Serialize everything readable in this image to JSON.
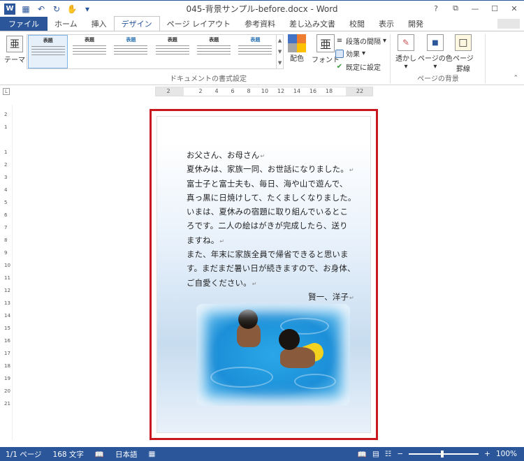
{
  "titlebar": {
    "title": "045-背景サンプル-before.docx - Word",
    "logo": "W",
    "qat": [
      "save-icon",
      "undo-icon",
      "redo-icon",
      "touch-mode-icon",
      "customize-icon"
    ],
    "controls": [
      "?",
      "⧉",
      "—",
      "☐",
      "✕"
    ]
  },
  "tabs": [
    {
      "label": "ファイル"
    },
    {
      "label": "ホーム"
    },
    {
      "label": "挿入"
    },
    {
      "label": "デザイン"
    },
    {
      "label": "ページ レイアウト"
    },
    {
      "label": "参考資料"
    },
    {
      "label": "差し込み文書"
    },
    {
      "label": "校閲"
    },
    {
      "label": "表示"
    },
    {
      "label": "開発"
    }
  ],
  "ribbon": {
    "theme_label": "テーマ",
    "theme_icon_text": "亜",
    "gallery_thumbs": [
      {
        "title": "表題",
        "blue": false
      },
      {
        "title": "表題",
        "blue": false
      },
      {
        "title": "表題",
        "blue": true
      },
      {
        "title": "表題",
        "blue": false
      },
      {
        "title": "表題",
        "blue": false
      },
      {
        "title": "表題",
        "blue": true
      }
    ],
    "doc_format_group": "ドキュメントの書式設定",
    "colors_label": "配色",
    "fonts_label": "フォント",
    "fonts_icon_text": "亜",
    "paragraph_spacing": "段落の間隔",
    "effects": "効果",
    "set_default": "既定に設定",
    "watermark": "透かし",
    "page_color": "ページの色",
    "page_borders_1": "ページ",
    "page_borders_2": "罫線",
    "page_bg_group": "ページの背景"
  },
  "ruler": {
    "ticks": [
      "2",
      "2",
      "4",
      "6",
      "8",
      "10",
      "12",
      "14",
      "16",
      "18",
      "22"
    ],
    "corner": "L"
  },
  "vruler": {
    "ticks": [
      "2",
      "1",
      "1",
      "2",
      "3",
      "4",
      "5",
      "6",
      "7",
      "8",
      "9",
      "10",
      "11",
      "12",
      "13",
      "14",
      "15",
      "16",
      "17",
      "18",
      "19",
      "20",
      "21"
    ]
  },
  "letter": {
    "lines": [
      {
        "text": "お父さん、お母さん",
        "mark": "↵"
      },
      {
        "text": "夏休みは、家族一同、お世話になりました。",
        "mark": "↵"
      },
      {
        "text": "富士子と富士夫も、毎日、海や山で遊んで、",
        "mark": ""
      },
      {
        "text": "真っ黒に日焼けして、たくましくなりました。",
        "mark": ""
      },
      {
        "text": "いまは、夏休みの宿題に取り組んでいるとこ",
        "mark": ""
      },
      {
        "text": "ろです。二人の絵はがきが完成したら、送り",
        "mark": ""
      },
      {
        "text": "ますね。",
        "mark": "↵"
      },
      {
        "text": "また、年末に家族全員で帰省できると思いま",
        "mark": ""
      },
      {
        "text": "す。まだまだ暑い日が続きますので、お身体、",
        "mark": ""
      },
      {
        "text": "ご自愛ください。",
        "mark": "↵"
      }
    ],
    "signature": "賢一、洋子",
    "signature_mark": "↵"
  },
  "status": {
    "page": "1/1 ページ",
    "words": "168 文字",
    "language": "日本語",
    "zoom": "100%",
    "zoom_level": 0.5
  },
  "colors": {
    "accent": "#2b579a",
    "frame": "#c8171f"
  }
}
